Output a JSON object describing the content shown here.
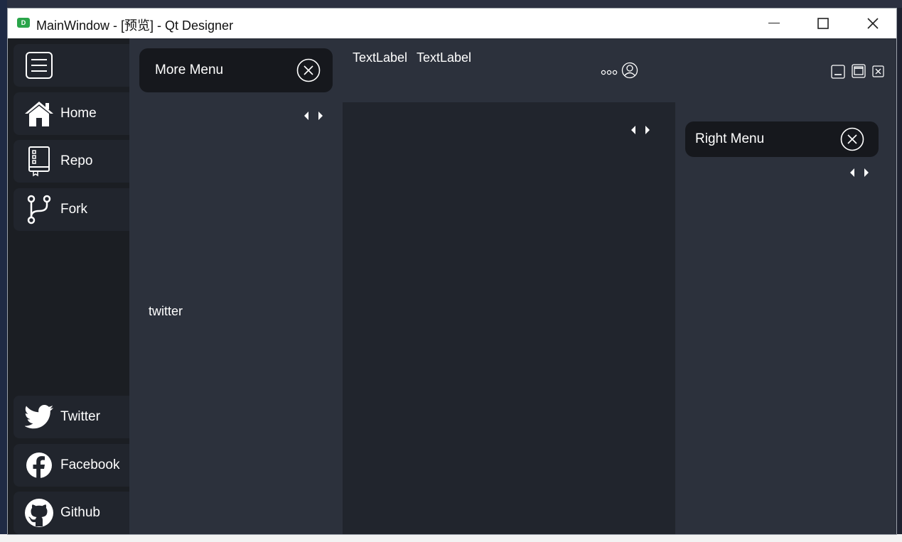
{
  "window": {
    "app_icon_letter": "D",
    "title": "MainWindow - [预览] - Qt Designer"
  },
  "sidebar": {
    "top_items": [
      {
        "label": "Home",
        "icon": "home-icon"
      },
      {
        "label": "Repo",
        "icon": "repo-icon"
      },
      {
        "label": "Fork",
        "icon": "fork-icon"
      }
    ],
    "bottom_items": [
      {
        "label": "Twitter",
        "icon": "twitter-icon"
      },
      {
        "label": "Facebook",
        "icon": "facebook-icon"
      },
      {
        "label": "Github",
        "icon": "github-icon"
      }
    ]
  },
  "more_menu": {
    "title": "More Menu",
    "body_text": "twitter"
  },
  "header": {
    "label1": "TextLabel",
    "label2": "TextLabel"
  },
  "right_menu": {
    "title": "Right Menu"
  },
  "colors": {
    "sidebar_bg": "#1b1e23",
    "panel_bg": "#2c313c",
    "content_bg": "#21252d",
    "pill_bg": "#16181d"
  }
}
